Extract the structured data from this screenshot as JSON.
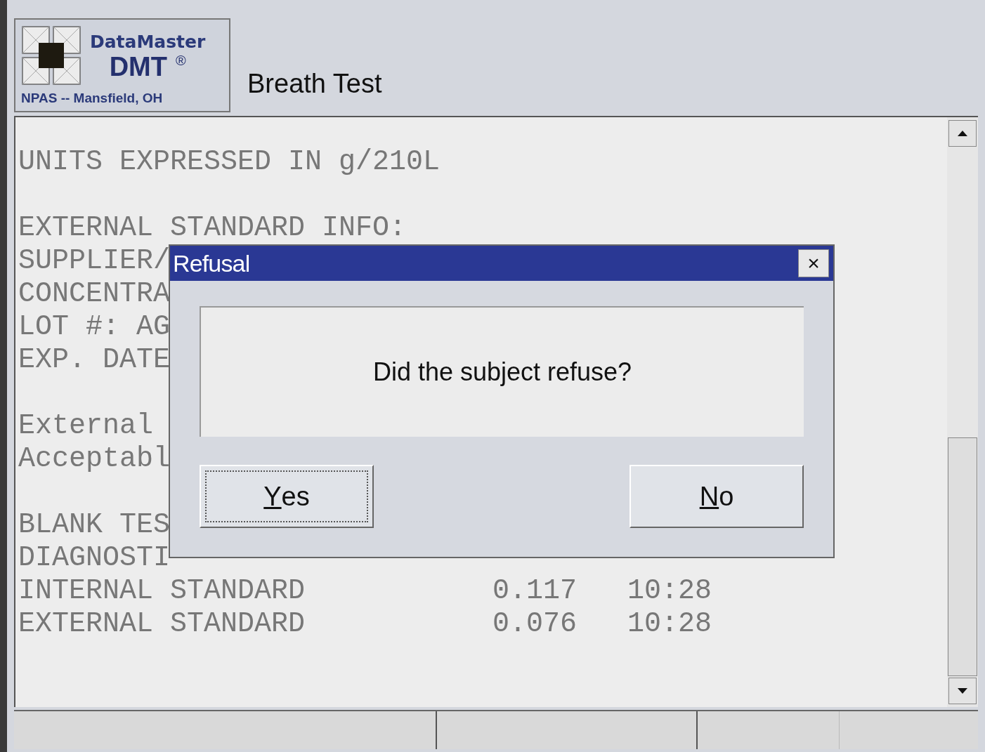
{
  "logo": {
    "title": "DataMaster",
    "model": "DMT",
    "mark": "®",
    "location": "NPAS -- Mansfield, OH"
  },
  "window": {
    "title": "Breath Test"
  },
  "report": {
    "lines": [
      {
        "kind": "text",
        "text": "UNITS EXPRESSED IN g/210L"
      },
      {
        "kind": "blank"
      },
      {
        "kind": "text",
        "text": "EXTERNAL STANDARD INFO:"
      },
      {
        "kind": "text",
        "text": "SUPPLIER/"
      },
      {
        "kind": "text",
        "text": "CONCENTRA"
      },
      {
        "kind": "text",
        "text": "LOT #: AG"
      },
      {
        "kind": "text",
        "text": "EXP. DATE"
      },
      {
        "kind": "blank"
      },
      {
        "kind": "text",
        "text": "External"
      },
      {
        "kind": "text",
        "text": "Acceptabl"
      },
      {
        "kind": "blank"
      },
      {
        "kind": "text",
        "text": "BLANK TES"
      },
      {
        "kind": "text",
        "text": "DIAGNOSTI"
      },
      {
        "kind": "row",
        "cells": [
          "INTERNAL STANDARD",
          "0.117",
          "10:28"
        ]
      },
      {
        "kind": "row",
        "cells": [
          "EXTERNAL STANDARD",
          "0.076",
          "10:28"
        ]
      }
    ]
  },
  "dialog": {
    "title": "Refusal",
    "close": "×",
    "message": "Did the subject refuse?",
    "buttons": [
      {
        "label": "Yes",
        "focused": true
      },
      {
        "label": "No",
        "focused": false
      }
    ]
  }
}
